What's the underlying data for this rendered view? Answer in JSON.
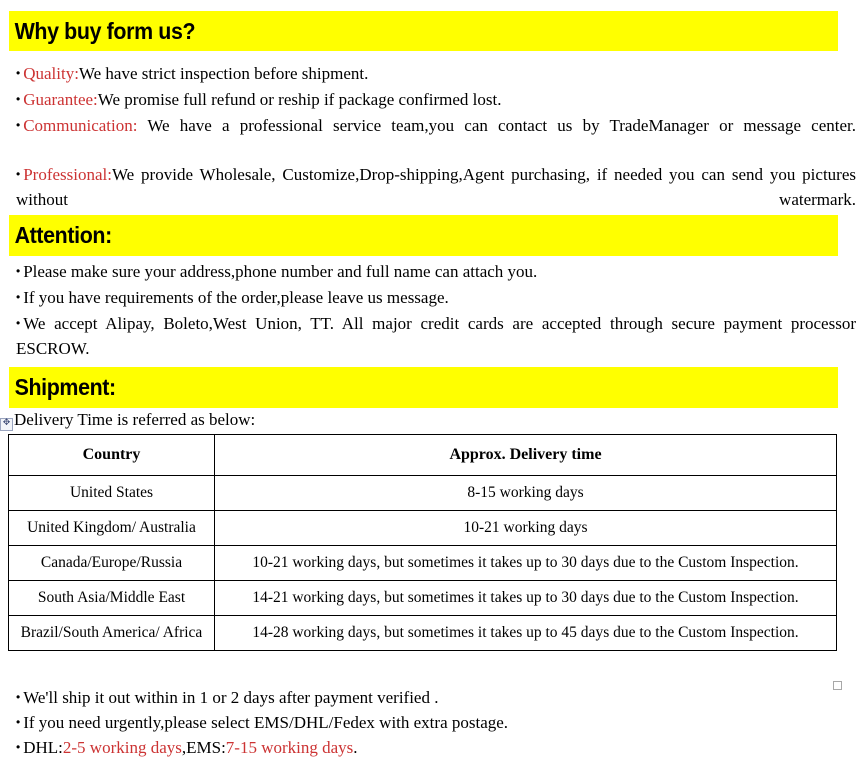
{
  "document": {
    "sections": [
      {
        "id": "why-buy",
        "heading": "Why buy form us?",
        "heading_background": "#ffff00"
      },
      {
        "id": "attention",
        "heading": "Attention:",
        "heading_background": "#ffff00"
      },
      {
        "id": "shipment",
        "heading": "Shipment:",
        "heading_background": "#ffff00"
      }
    ]
  },
  "colors": {
    "highlight_background": "#ffff00",
    "emphasis_red": "#cc3333",
    "text": "#000000",
    "table_border": "#000000"
  },
  "bullet_glyph": "•",
  "why_buy": {
    "items": [
      {
        "label": "Quality:",
        "text": "We have strict inspection before shipment."
      },
      {
        "label": "Guarantee:",
        "text": "We promise full refund or reship if package confirmed lost."
      },
      {
        "label": "Communication:",
        "text": " We have a professional service team,you can contact us by TradeManager or message center."
      },
      {
        "label": "Professional:",
        "text": "We provide Wholesale, Customize,Drop-shipping,Agent purchasing, if needed you can send you pictures without watermark."
      }
    ]
  },
  "attention": {
    "items": [
      {
        "text": "Please make sure your address,phone number and full name can attach you."
      },
      {
        "text": "If you have requirements of the order,please leave us message."
      },
      {
        "text": "We accept Alipay, Boleto,West Union, TT. All major credit cards are accepted through secure payment processor ESCROW."
      }
    ]
  },
  "shipment": {
    "intro": "Delivery Time is referred as below:",
    "table": {
      "headers": [
        "Country",
        "Approx. Delivery time"
      ],
      "rows": [
        [
          "United States",
          "8-15 working days"
        ],
        [
          "United Kingdom/ Australia",
          "10-21 working days"
        ],
        [
          "Canada/Europe/Russia",
          "10-21 working days, but sometimes it takes up to 30 days due to the Custom Inspection."
        ],
        [
          "South Asia/Middle East",
          "14-21 working days, but sometimes it takes up to 30 days due to the Custom Inspection."
        ],
        [
          "Brazil/South America/ Africa",
          "14-28 working days, but sometimes it takes up to 45 days due to the Custom Inspection."
        ]
      ]
    },
    "notes": [
      {
        "text": "We'll ship it out within in 1 or 2 days after payment verified ."
      },
      {
        "text": "If you need urgently,please select EMS/DHL/Fedex with extra postage."
      }
    ],
    "courier_note": {
      "dhl_label": "DHL:",
      "dhl_value": "2-5 working days",
      "separator": ",",
      "ems_label": "EMS:",
      "ems_value": "7-15 working days",
      "end": "."
    }
  },
  "handles": {
    "table_move": "✥",
    "table_resize": "resize-handle"
  }
}
